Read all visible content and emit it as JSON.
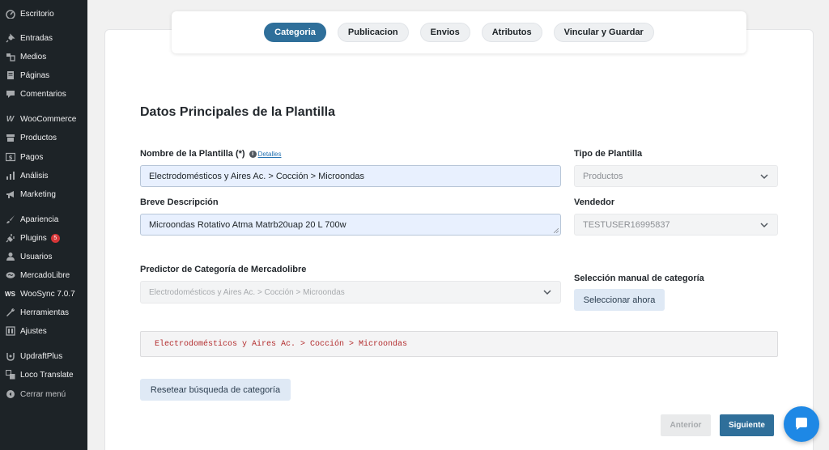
{
  "sidebar": {
    "items": [
      {
        "label": "Escritorio",
        "icon": "dashboard-icon"
      },
      {
        "label": "Entradas",
        "icon": "pin-icon"
      },
      {
        "label": "Medios",
        "icon": "media-icon"
      },
      {
        "label": "Páginas",
        "icon": "page-icon"
      },
      {
        "label": "Comentarios",
        "icon": "comment-icon"
      },
      {
        "label": "WooCommerce",
        "icon": "woocommerce-icon"
      },
      {
        "label": "Productos",
        "icon": "archive-icon"
      },
      {
        "label": "Pagos",
        "icon": "dollar-icon"
      },
      {
        "label": "Análisis",
        "icon": "bar-chart-icon"
      },
      {
        "label": "Marketing",
        "icon": "megaphone-icon"
      },
      {
        "label": "Apariencia",
        "icon": "brush-icon"
      },
      {
        "label": "Plugins",
        "icon": "plug-icon",
        "badge": "5"
      },
      {
        "label": "Usuarios",
        "icon": "user-icon"
      },
      {
        "label": "MercadoLibre",
        "icon": "handshake-icon"
      },
      {
        "label": "WooSync 7.0.7",
        "icon": "ws-icon"
      },
      {
        "label": "Herramientas",
        "icon": "wrench-icon"
      },
      {
        "label": "Ajustes",
        "icon": "settings-icon"
      },
      {
        "label": "UpdraftPlus",
        "icon": "updraft-icon"
      },
      {
        "label": "Loco Translate",
        "icon": "translate-icon"
      },
      {
        "label": "Cerrar menú",
        "icon": "collapse-icon"
      }
    ]
  },
  "tabs": [
    {
      "label": "Categoria",
      "active": true
    },
    {
      "label": "Publicacion",
      "active": false
    },
    {
      "label": "Envios",
      "active": false
    },
    {
      "label": "Atributos",
      "active": false
    },
    {
      "label": "Vincular y Guardar",
      "active": false
    }
  ],
  "form": {
    "title": "Datos Principales de la Plantilla",
    "nombre_label": "Nombre de la Plantilla (*)",
    "detalles_link": "Detalles",
    "nombre_value": "Electrodomésticos y Aires Ac. > Cocción > Microondas",
    "descripcion_label": "Breve Descripción",
    "descripcion_value": "Microondas Rotativo Atma Matrb20uap 20 L 700w",
    "tipo_label": "Tipo de Plantilla",
    "tipo_value": "Productos",
    "vendedor_label": "Vendedor",
    "vendedor_value": "TESTUSER16995837",
    "predictor_label": "Predictor de Categoría de Mercadolibre",
    "predictor_value": "Electrodomésticos y Aires Ac. > Cocción > Microondas",
    "manual_label": "Selección manual de categoría",
    "manual_button": "Seleccionar ahora",
    "category_path": "Electrodomésticos y Aires Ac. > Cocción > Microondas",
    "reset_button": "Resetear búsqueda de categoría"
  },
  "footer": {
    "prev_button": "Anterior",
    "next_button": "Siguiente"
  },
  "colors": {
    "sidebar_bg": "#1d2327",
    "primary": "#2f6f9a",
    "chat_button": "#1e88e5",
    "code_text": "#b32d2e"
  }
}
